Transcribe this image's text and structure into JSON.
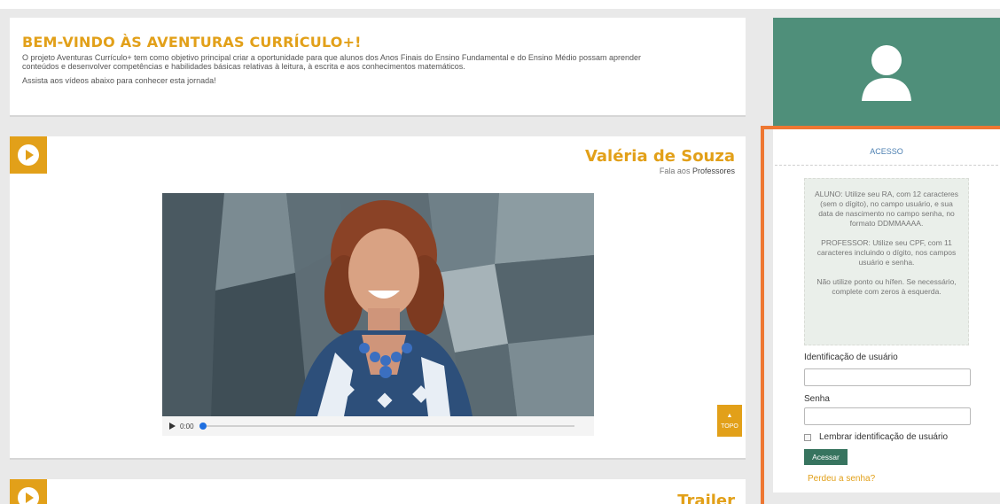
{
  "welcome": {
    "title": "BEM-VINDO ÀS AVENTURAS CURRÍCULO+!",
    "line1": "O projeto Aventuras Currículo+ tem como objetivo principal criar a oportunidade para que alunos dos Anos Finais do Ensino Fundamental e do Ensino Médio possam aprender",
    "line2": "conteúdos e desenvolver competências e habilidades básicas relativas à leitura, à escrita e aos conhecimentos matemáticos.",
    "hint": "Assista aos vídeos abaixo para conhecer esta jornada!"
  },
  "video1": {
    "name": "Valéria de Souza",
    "subtitle_prefix": "Fala aos",
    "subtitle_strong": "Professores",
    "time": "0:00",
    "topo_arrow": "▲",
    "topo_label": "TOPO"
  },
  "video2": {
    "name": "Trailer"
  },
  "access": {
    "title": "ACESSO",
    "info_aluno": "ALUNO: Utilize seu RA, com 12 caracteres (sem o dígito), no campo usuário, e sua data de nascimento no campo senha, no formato DDMMAAAA.",
    "info_professor": "PROFESSOR: Utilize seu CPF, com 11 caracteres incluindo o dígito, nos campos usuário e senha.",
    "info_note": "Não utilize ponto ou hífen. Se necessário, complete com zeros à esquerda.",
    "user_label": "Identificação de usuário",
    "user_value": "",
    "password_label": "Senha",
    "password_value": "",
    "remember_label": "Lembrar identificação de usuário",
    "submit_label": "Acessar",
    "lost_password": "Perdeu a senha?"
  },
  "colors": {
    "accent": "#e2a019",
    "panel_green": "#4f8f7a",
    "button_green": "#37745f",
    "highlight_frame": "#ee7732"
  },
  "icons": {
    "play": "play-circle-icon",
    "user": "user-silhouette-icon"
  }
}
